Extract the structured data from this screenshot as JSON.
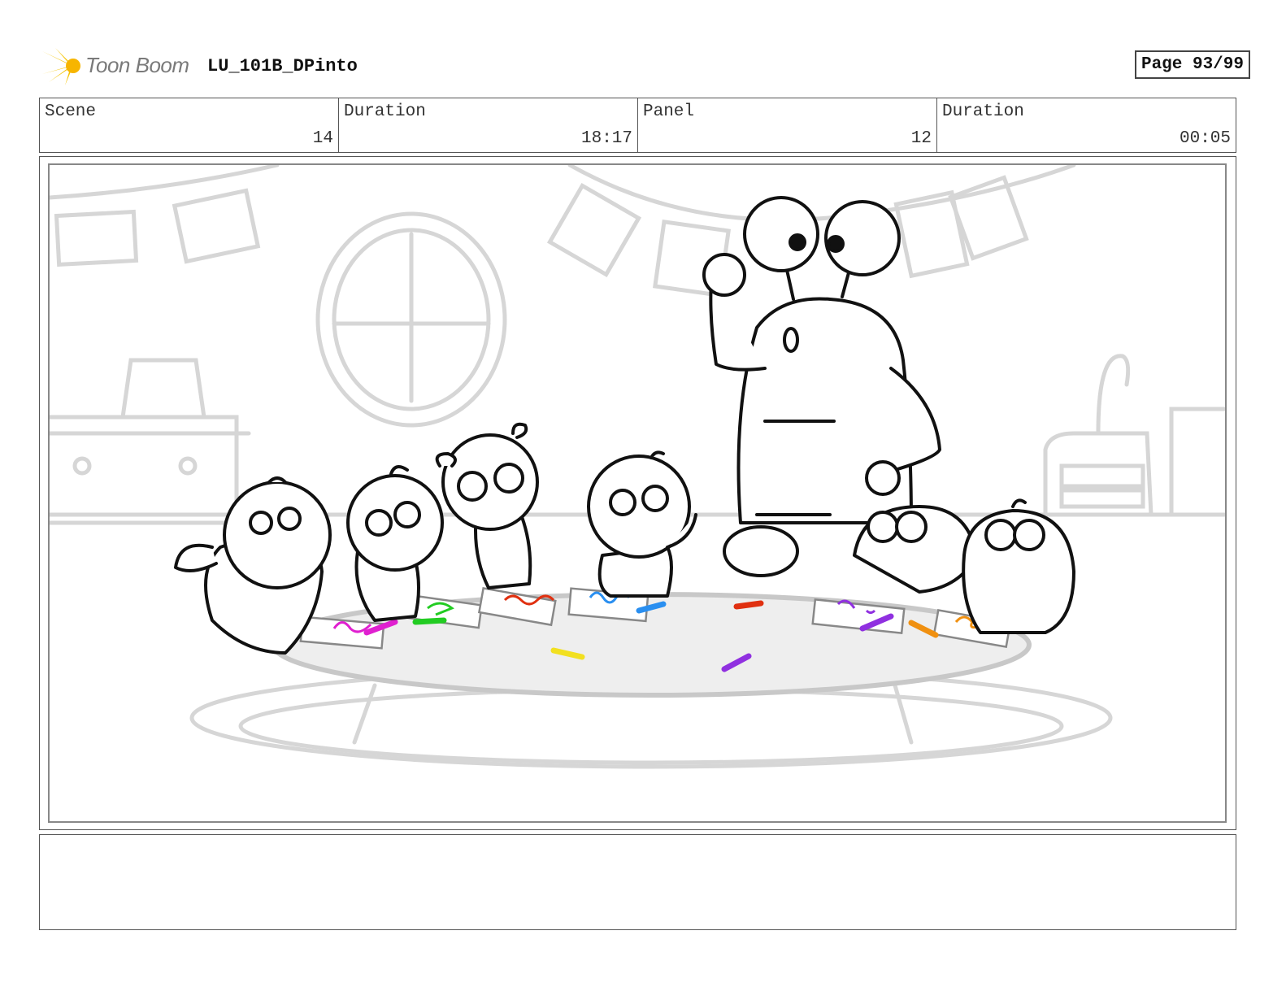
{
  "header": {
    "logo_text": "Toon Boom",
    "doc_title": "LU_101B_DPinto",
    "page_label": "Page 93/99"
  },
  "info": [
    {
      "label": "Scene",
      "value": "14"
    },
    {
      "label": "Duration",
      "value": "18:17"
    },
    {
      "label": "Panel",
      "value": "12"
    },
    {
      "label": "Duration",
      "value": "00:05"
    }
  ],
  "colors": {
    "logo_yellow": "#f5c400",
    "crayon_magenta": "#e020d0",
    "crayon_green": "#22cc22",
    "crayon_red": "#e03010",
    "crayon_blue": "#2a8ff0",
    "crayon_yellow": "#f2e020",
    "crayon_purple": "#9030e0",
    "crayon_orange": "#f09010"
  },
  "panel": {
    "image_description": "storyboard-sketch-classroom-table"
  },
  "notes": {
    "text": ""
  }
}
